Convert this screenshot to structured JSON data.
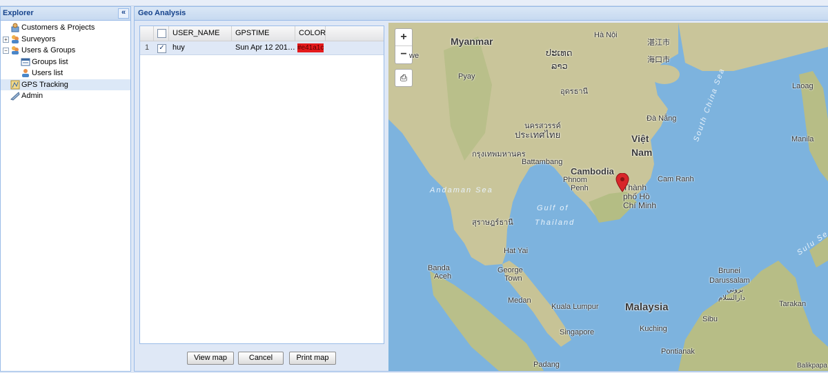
{
  "explorer": {
    "title": "Explorer",
    "collapse_glyph": "«",
    "items": [
      {
        "label": "Customers & Projects",
        "icon": "customers-projects-icon",
        "expander": ""
      },
      {
        "label": "Surveyors",
        "icon": "surveyors-icon",
        "expander": "+"
      },
      {
        "label": "Users & Groups",
        "icon": "users-groups-icon",
        "expander": "−"
      },
      {
        "label": "Groups list",
        "icon": "groups-list-icon",
        "expander": ""
      },
      {
        "label": "Users list",
        "icon": "users-list-icon",
        "expander": ""
      },
      {
        "label": "GPS Tracking",
        "icon": "gps-tracking-icon",
        "expander": "",
        "selected": true
      },
      {
        "label": "Admin",
        "icon": "admin-icon",
        "expander": ""
      }
    ]
  },
  "geo": {
    "title": "Geo Analysis",
    "columns": [
      "USER_NAME",
      "GPSTIME",
      "COLOR"
    ],
    "rows": [
      {
        "index": "1",
        "checked": true,
        "user_name": "huy",
        "gpstime": "Sun Apr 12 201…",
        "color": "#e41a1c"
      }
    ],
    "buttons": {
      "view": "View map",
      "cancel": "Cancel",
      "print": "Print map"
    }
  },
  "map": {
    "zoom_in": "+",
    "zoom_out": "−",
    "labels": {
      "myanmar": "Myanmar",
      "ha_noi": "Hà Nội",
      "zhanjiang": "湛江市",
      "haikou": "海口市",
      "laos1": "ປະເທດ",
      "laos2": "ລາວ",
      "udon": "อุดรธานี",
      "pyay": "Pyay",
      "laoag": "Laoag",
      "da_nang": "Đà Nẵng",
      "nakhon": "นครสวรรค์",
      "thai1": "ประเทศไทย",
      "viet": "Việt",
      "nam": "Nam",
      "bangkok": "กรุงเทพมหานคร",
      "manila": "Manila",
      "battambang": "Battambang",
      "cambodia": "Cambodia",
      "phnom": "Phnom",
      "penh": "Penh",
      "thanh": "Thành",
      "pho_ho": "phố Hồ",
      "chi_minh": "Chí Minh",
      "cam_ranh": "Cam Ranh",
      "andaman": "Andaman Sea",
      "gulf_of": "Gulf of",
      "thailand": "Thailand",
      "south_china_sea": "South China Sea",
      "surat": "สุราษฎร์ธานี",
      "hat_yai": "Hat Yai",
      "banda1": "Banda",
      "banda2": "Aceh",
      "george1": "George",
      "george2": "Town",
      "medan": "Medan",
      "kuala": "Kuala Lumpur",
      "malaysia": "Malaysia",
      "brunei1": "Brunei",
      "brunei2": "Darussalam",
      "brunei3": "بروني",
      "brunei4": "دارالسلام",
      "tarakan": "Tarakan",
      "sibu": "Sibu",
      "kuching": "Kuching",
      "singapore": "Singapore",
      "pontianak": "Pontianak",
      "padang": "Padang",
      "sulu": "Sulu Se",
      "we": "we",
      "balikpapan": "Balikpapa"
    }
  }
}
